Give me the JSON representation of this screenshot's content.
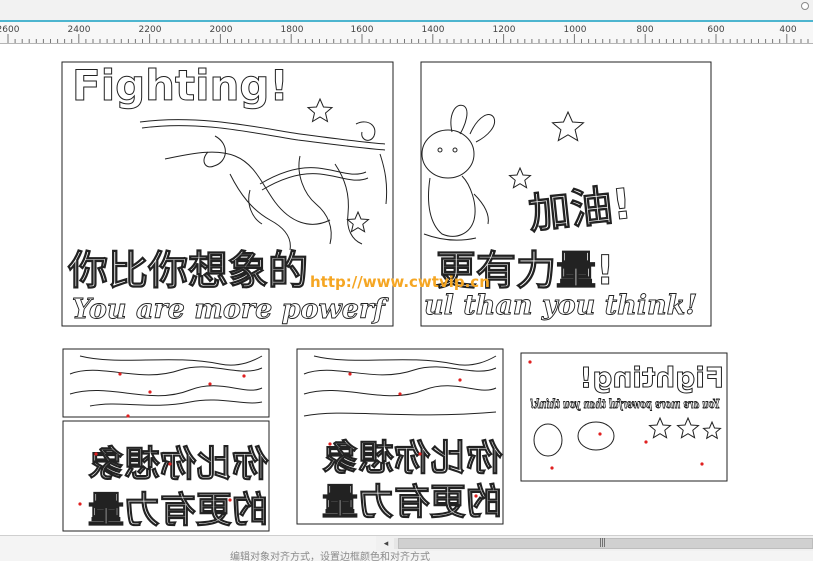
{
  "ruler": {
    "ticks": [
      "2600",
      "2400",
      "2200",
      "2000",
      "1800",
      "1600",
      "1400",
      "1200",
      "1000",
      "800",
      "600",
      "400"
    ]
  },
  "poster": {
    "title": "Fighting!",
    "jiayou": "加油!",
    "slogan_cn_left": "你比你想象的",
    "slogan_cn_right": "更有力量!",
    "slogan_en_left": "You are more powerf",
    "slogan_en_right": "ul than you think!"
  },
  "watermark": "http://www.cwtvip.cn",
  "pieces": {
    "mirrored_cn_1": "你比你想象",
    "mirrored_cn_2": "的更有力量",
    "mirrored_title": "Fighting!",
    "mirrored_en": "You are more powerful than you think!"
  },
  "scrollbar": {
    "left_arrow": "◂",
    "right_arrow": "▸",
    "grip": "|||"
  },
  "status": {
    "hint": "编辑对象对齐方式，设置边框颜色和对齐方式"
  },
  "colors": {
    "accent": "#4db5cf",
    "outline": "#222222",
    "marker": "#e02020",
    "watermark": "#f5a623"
  }
}
